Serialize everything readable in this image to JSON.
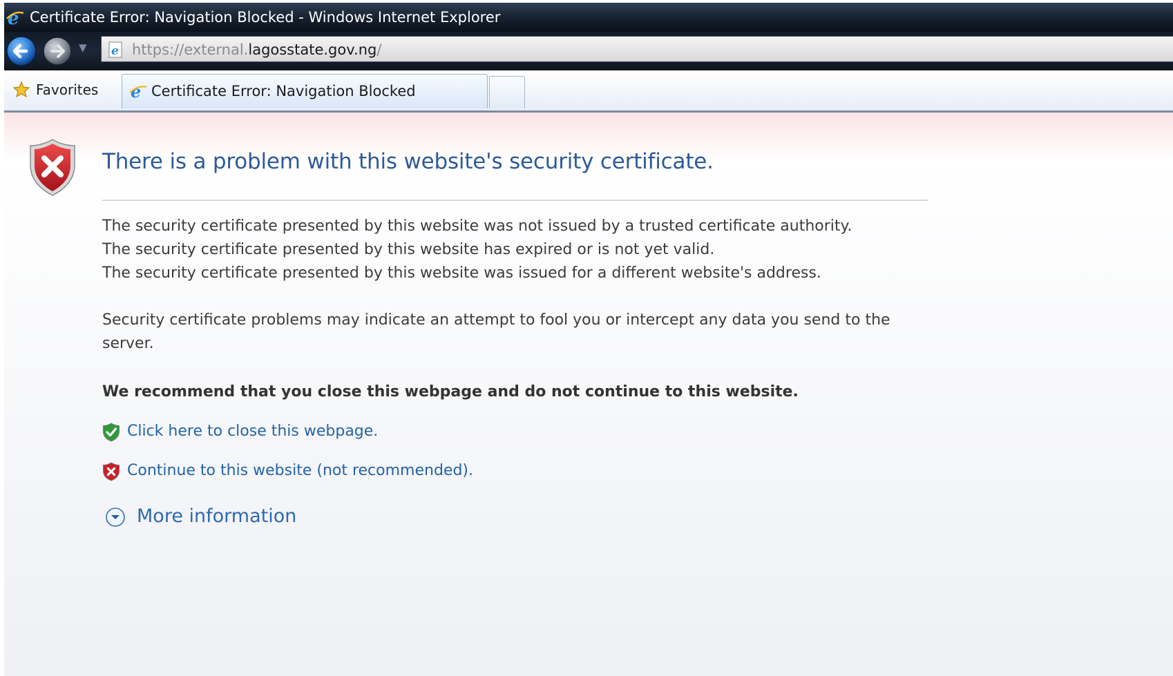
{
  "window": {
    "title": "Certificate Error: Navigation Blocked - Windows Internet Explorer"
  },
  "address_bar": {
    "url_protocol": "https://external.",
    "url_host": "lagosstate.gov.ng",
    "url_trailing": "/"
  },
  "favorites": {
    "label": "Favorites"
  },
  "tabs": [
    {
      "label": "Certificate Error: Navigation Blocked",
      "active": true
    }
  ],
  "page": {
    "heading": "There is a problem with this website's security certificate.",
    "reasons": [
      "The security certificate presented by this website was not issued by a trusted certificate authority.",
      "The security certificate presented by this website has expired or is not yet valid.",
      "The security certificate presented by this website was issued for a different website's address."
    ],
    "warning": "Security certificate problems may indicate an attempt to fool you or intercept any data you send to the server.",
    "recommendation": "We recommend that you close this webpage and do not continue to this website.",
    "close_link": "Click here to close this webpage.",
    "continue_link": "Continue to this website (not recommended).",
    "more_info": "More information"
  },
  "icons": {
    "window_logo": "ie-logo-icon",
    "back": "back-arrow-icon",
    "forward": "forward-arrow-icon",
    "favorites": "star-icon",
    "error": "shield-x-icon",
    "safe": "shield-check-icon",
    "unsafe": "shield-x-small-icon",
    "expand": "chevron-down-circle-icon"
  },
  "colors": {
    "heading": "#2e5a98",
    "link": "#2264a8",
    "error_red": "#c8202a",
    "safe_green": "#2f9a3a"
  }
}
